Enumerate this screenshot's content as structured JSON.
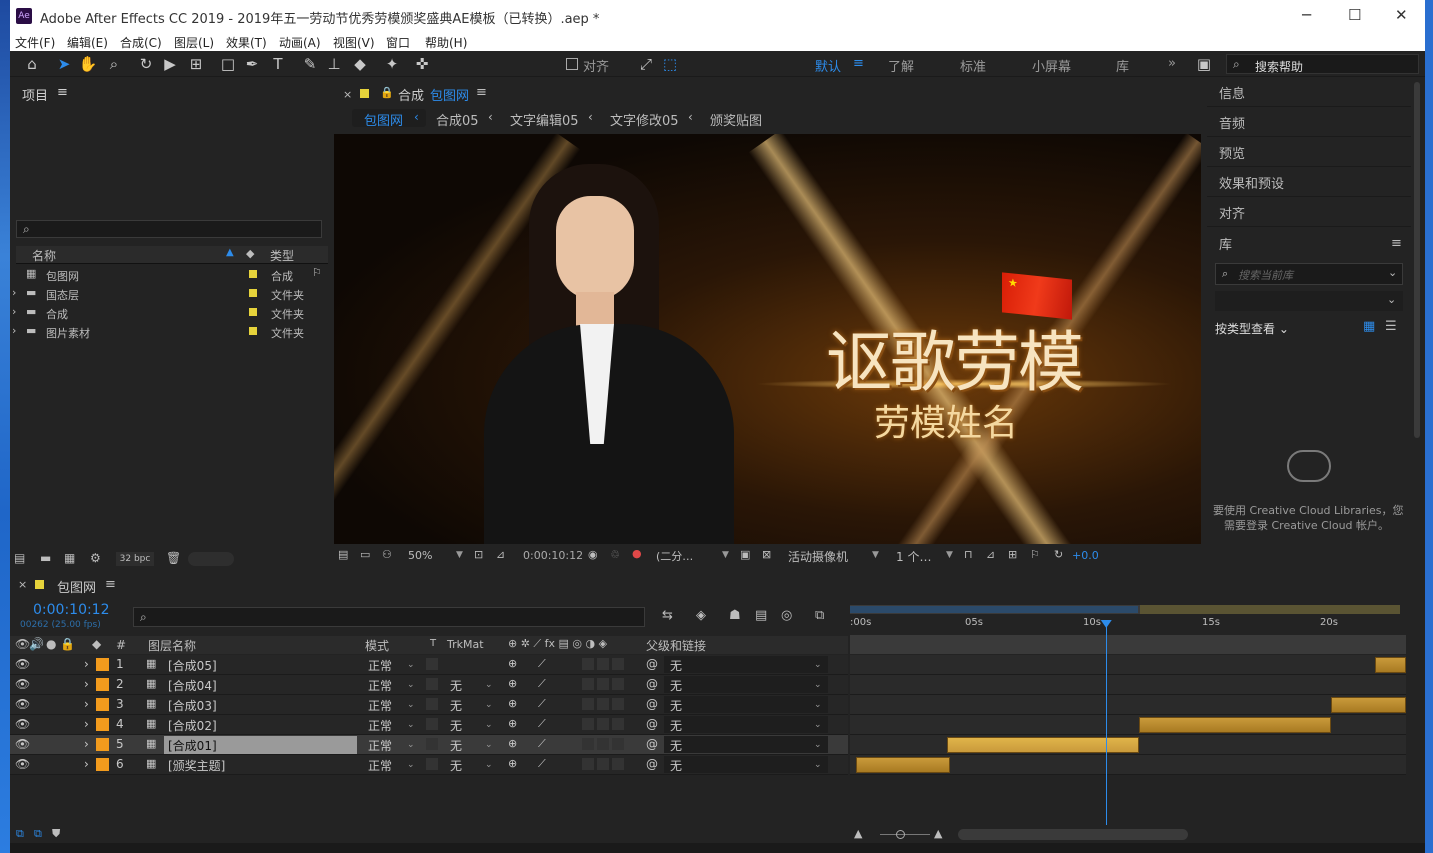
{
  "window": {
    "app_badge": "Ae",
    "title": "Adobe After Effects CC 2019 - 2019年五一劳动节优秀劳模颁奖盛典AE模板（已转换）.aep *",
    "minimize": "─",
    "maximize": "☐",
    "close": "✕"
  },
  "menu": [
    "文件(F)",
    "编辑(E)",
    "合成(C)",
    "图层(L)",
    "效果(T)",
    "动画(A)",
    "视图(V)",
    "窗口",
    "帮助(H)"
  ],
  "toolbar": {
    "align_label": "对齐",
    "workspaces": [
      "默认",
      "了解",
      "标准",
      "小屏幕",
      "库"
    ],
    "search_help": "搜索帮助"
  },
  "project": {
    "title": "项目",
    "search_placeholder": "",
    "col_name": "名称",
    "col_type": "类型",
    "items": [
      {
        "name": "包图网",
        "type": "合成"
      },
      {
        "name": "国态层",
        "type": "文件夹"
      },
      {
        "name": "合成",
        "type": "文件夹"
      },
      {
        "name": "图片素材",
        "type": "文件夹"
      }
    ],
    "bpc": "32 bpc"
  },
  "composition": {
    "tab_prefix": "合成",
    "tab_name": "包图网",
    "breadcrumbs": [
      "包图网",
      "合成05",
      "文字编辑05",
      "文字修改05",
      "颁奖贴图"
    ],
    "viewer_title": "讴歌劳模",
    "viewer_subtitle": "劳模姓名",
    "zoom": "50%",
    "timecode": "0:00:10:12",
    "resolution": "(二分…",
    "camera": "活动摄像机",
    "views": "1 个…",
    "exposure": "+0.0"
  },
  "right_panel": {
    "items": [
      "信息",
      "音频",
      "预览",
      "效果和预设",
      "对齐"
    ],
    "library_title": "库",
    "library_search_placeholder": "搜索当前库",
    "view_by": "按类型查看",
    "cc_message_1": "要使用 Creative Cloud Libraries，您",
    "cc_message_2": "需要登录 Creative Cloud 帐户。"
  },
  "timeline": {
    "tab": "包图网",
    "timecode": "0:00:10:12",
    "frames": "00262 (25.00 fps)",
    "col_num": "#",
    "col_layer": "图层名称",
    "col_mode": "模式",
    "col_t": "T",
    "col_trkmat": "TrkMat",
    "col_parent": "父级和链接",
    "ruler": [
      ":00s",
      "05s",
      "10s",
      "15s",
      "20s"
    ],
    "layers": [
      {
        "num": "1",
        "name": "[合成05]",
        "mode": "正常",
        "trkmat": "",
        "parent": "无",
        "bar_start": 0.945,
        "bar_end": 1.0
      },
      {
        "num": "2",
        "name": "[合成04]",
        "mode": "正常",
        "trkmat": "无",
        "parent": "无",
        "bar_start": 0.0,
        "bar_end": 0.0
      },
      {
        "num": "3",
        "name": "[合成03]",
        "mode": "正常",
        "trkmat": "无",
        "parent": "无",
        "bar_start": 0.865,
        "bar_end": 1.0
      },
      {
        "num": "4",
        "name": "[合成02]",
        "mode": "正常",
        "trkmat": "无",
        "parent": "无",
        "bar_start": 0.52,
        "bar_end": 0.865
      },
      {
        "num": "5",
        "name": "[合成01]",
        "mode": "正常",
        "trkmat": "无",
        "parent": "无",
        "bar_start": 0.175,
        "bar_end": 0.52
      },
      {
        "num": "6",
        "name": "[颁奖主题]",
        "mode": "正常",
        "trkmat": "无",
        "parent": "无",
        "bar_start": 0.01,
        "bar_end": 0.18
      }
    ],
    "playhead_fraction": 0.46
  },
  "colors": {
    "accent": "#2d8ceb",
    "bar": "#c99a3b",
    "label_orange": "#f29b1d"
  }
}
